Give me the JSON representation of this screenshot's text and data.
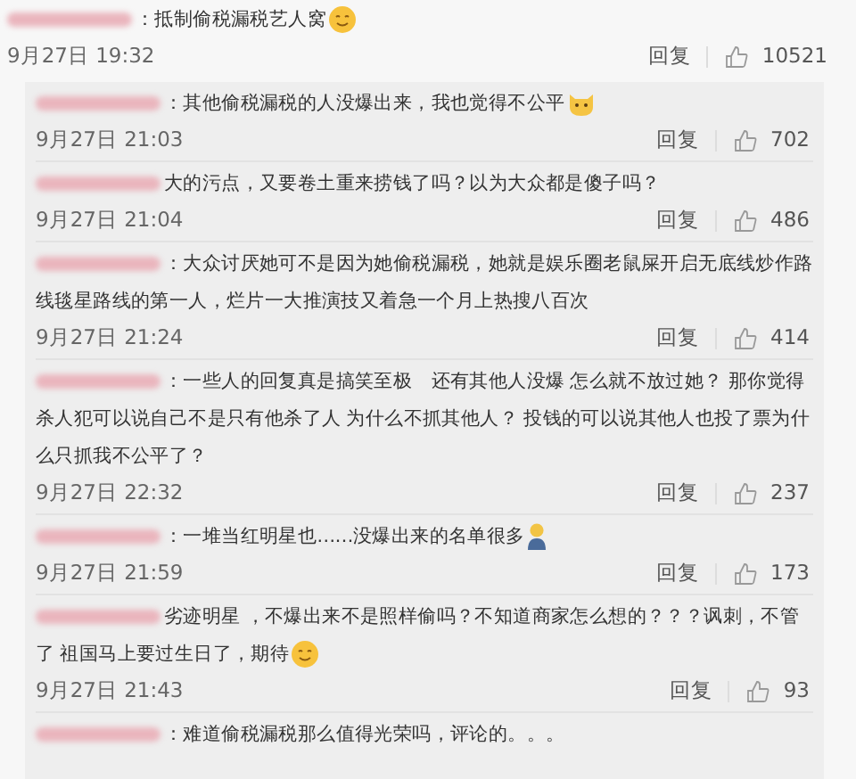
{
  "comments": [
    {
      "kind": "top",
      "text": "：抵制偷税漏税艺人窝",
      "emoji": {
        "kind": "smile"
      },
      "time": "9月27日 19:32",
      "reply": "回复",
      "likes": "10521"
    },
    {
      "kind": "reply",
      "text": "：其他偷税漏税的人没爆出来，我也觉得不公平",
      "emoji": {
        "kind": "cat"
      },
      "time": "9月27日 21:03",
      "reply": "回复",
      "likes": "702"
    },
    {
      "kind": "reply",
      "text": "大的污点，又要卷土重来捞钱了吗？以为大众都是傻子吗？",
      "time": "9月27日 21:04",
      "reply": "回复",
      "likes": "486"
    },
    {
      "kind": "reply",
      "text": "：大众讨厌她可不是因为她偷税漏税，她就是娱乐圈老鼠屎开启无底线炒作路线毯星路线的第一人，烂片一大推演技又着急一个月上热搜八百次",
      "time": "9月27日 21:24",
      "reply": "回复",
      "likes": "414"
    },
    {
      "kind": "reply",
      "text": "：一些人的回复真是搞笑至极　还有其他人没爆 怎么就不放过她？ 那你觉得杀人犯可以说自己不是只有他杀了人 为什么不抓其他人？ 投钱的可以说其他人也投了票为什么只抓我不公平了？",
      "time": "9月27日 22:32",
      "reply": "回复",
      "likes": "237"
    },
    {
      "kind": "reply",
      "text": "：一堆当红明星也……没爆出来的名单很多",
      "emoji": {
        "kind": "figure"
      },
      "time": "9月27日 21:59",
      "reply": "回复",
      "likes": "173"
    },
    {
      "kind": "reply",
      "text": "劣迹明星 ，不爆出来不是照样偷吗？不知道商家怎么想的？？？讽刺，不管了 祖国马上要过生日了，期待",
      "emoji": {
        "kind": "smile"
      },
      "time": "9月27日 21:43",
      "reply": "回复",
      "likes": "93"
    },
    {
      "kind": "reply",
      "text": "：难道偷税漏税那么值得光荣吗，评论的。。。"
    }
  ]
}
